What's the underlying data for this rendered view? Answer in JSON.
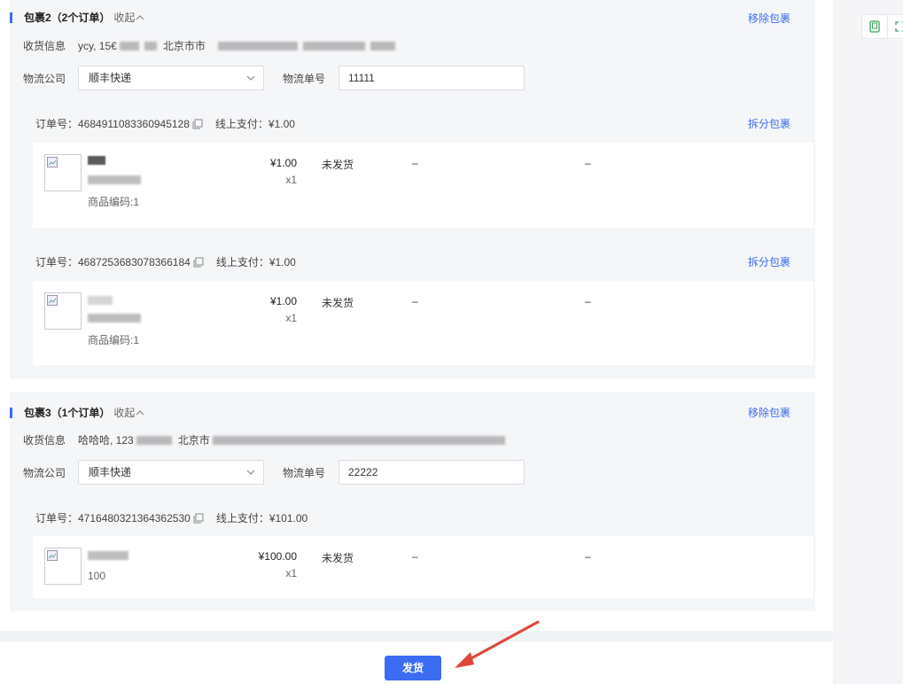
{
  "packages": [
    {
      "title": "包裹2（2个订单）",
      "collapse_label": "收起",
      "remove_label": "移除包裹",
      "address_label": "收货信息",
      "address_text": "ycy, 15€",
      "address_text2": "北京市市",
      "carrier_label": "物流公司",
      "carrier_value": "顺丰快递",
      "tracking_label": "物流单号",
      "tracking_value": "11111",
      "orders": [
        {
          "order_no": "订单号：4684911083360945128",
          "payment": "线上支付：¥1.00",
          "split_label": "拆分包裹",
          "code": "商品编码:1",
          "price": "¥1.00",
          "qty": "x1",
          "status": "未发货",
          "dash1": "–",
          "dash2": "–"
        },
        {
          "order_no": "订单号：4687253683078366184",
          "payment": "线上支付：¥1.00",
          "split_label": "拆分包裹",
          "code": "商品编码:1",
          "price": "¥1.00",
          "qty": "x1",
          "status": "未发货",
          "dash1": "–",
          "dash2": "–"
        }
      ]
    },
    {
      "title": "包裹3（1个订单）",
      "collapse_label": "收起",
      "remove_label": "移除包裹",
      "address_label": "收货信息",
      "address_text": "哈哈哈, 123",
      "address_text2": "北京市",
      "carrier_label": "物流公司",
      "carrier_value": "顺丰快递",
      "tracking_label": "物流单号",
      "tracking_value": "22222",
      "orders": [
        {
          "order_no": "订单号：4716480321364362530",
          "payment": "线上支付：¥101.00",
          "code": "100",
          "price": "¥100.00",
          "qty": "x1",
          "status": "未发货",
          "dash1": "–",
          "dash2": "–"
        }
      ]
    }
  ],
  "ship_button": "发货",
  "accent_color": "#3b6cf2",
  "arrow_color": "#e0473b"
}
